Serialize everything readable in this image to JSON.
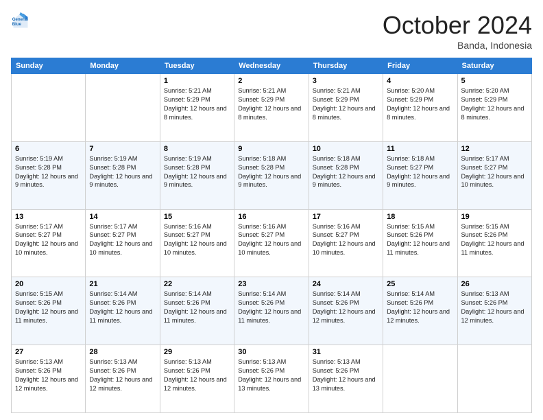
{
  "logo": {
    "line1": "General",
    "line2": "Blue"
  },
  "header": {
    "month": "October 2024",
    "location": "Banda, Indonesia"
  },
  "weekdays": [
    "Sunday",
    "Monday",
    "Tuesday",
    "Wednesday",
    "Thursday",
    "Friday",
    "Saturday"
  ],
  "weeks": [
    [
      {
        "day": null,
        "sunrise": null,
        "sunset": null,
        "daylight": null
      },
      {
        "day": null,
        "sunrise": null,
        "sunset": null,
        "daylight": null
      },
      {
        "day": "1",
        "sunrise": "Sunrise: 5:21 AM",
        "sunset": "Sunset: 5:29 PM",
        "daylight": "Daylight: 12 hours and 8 minutes."
      },
      {
        "day": "2",
        "sunrise": "Sunrise: 5:21 AM",
        "sunset": "Sunset: 5:29 PM",
        "daylight": "Daylight: 12 hours and 8 minutes."
      },
      {
        "day": "3",
        "sunrise": "Sunrise: 5:21 AM",
        "sunset": "Sunset: 5:29 PM",
        "daylight": "Daylight: 12 hours and 8 minutes."
      },
      {
        "day": "4",
        "sunrise": "Sunrise: 5:20 AM",
        "sunset": "Sunset: 5:29 PM",
        "daylight": "Daylight: 12 hours and 8 minutes."
      },
      {
        "day": "5",
        "sunrise": "Sunrise: 5:20 AM",
        "sunset": "Sunset: 5:29 PM",
        "daylight": "Daylight: 12 hours and 8 minutes."
      }
    ],
    [
      {
        "day": "6",
        "sunrise": "Sunrise: 5:19 AM",
        "sunset": "Sunset: 5:28 PM",
        "daylight": "Daylight: 12 hours and 9 minutes."
      },
      {
        "day": "7",
        "sunrise": "Sunrise: 5:19 AM",
        "sunset": "Sunset: 5:28 PM",
        "daylight": "Daylight: 12 hours and 9 minutes."
      },
      {
        "day": "8",
        "sunrise": "Sunrise: 5:19 AM",
        "sunset": "Sunset: 5:28 PM",
        "daylight": "Daylight: 12 hours and 9 minutes."
      },
      {
        "day": "9",
        "sunrise": "Sunrise: 5:18 AM",
        "sunset": "Sunset: 5:28 PM",
        "daylight": "Daylight: 12 hours and 9 minutes."
      },
      {
        "day": "10",
        "sunrise": "Sunrise: 5:18 AM",
        "sunset": "Sunset: 5:28 PM",
        "daylight": "Daylight: 12 hours and 9 minutes."
      },
      {
        "day": "11",
        "sunrise": "Sunrise: 5:18 AM",
        "sunset": "Sunset: 5:27 PM",
        "daylight": "Daylight: 12 hours and 9 minutes."
      },
      {
        "day": "12",
        "sunrise": "Sunrise: 5:17 AM",
        "sunset": "Sunset: 5:27 PM",
        "daylight": "Daylight: 12 hours and 10 minutes."
      }
    ],
    [
      {
        "day": "13",
        "sunrise": "Sunrise: 5:17 AM",
        "sunset": "Sunset: 5:27 PM",
        "daylight": "Daylight: 12 hours and 10 minutes."
      },
      {
        "day": "14",
        "sunrise": "Sunrise: 5:17 AM",
        "sunset": "Sunset: 5:27 PM",
        "daylight": "Daylight: 12 hours and 10 minutes."
      },
      {
        "day": "15",
        "sunrise": "Sunrise: 5:16 AM",
        "sunset": "Sunset: 5:27 PM",
        "daylight": "Daylight: 12 hours and 10 minutes."
      },
      {
        "day": "16",
        "sunrise": "Sunrise: 5:16 AM",
        "sunset": "Sunset: 5:27 PM",
        "daylight": "Daylight: 12 hours and 10 minutes."
      },
      {
        "day": "17",
        "sunrise": "Sunrise: 5:16 AM",
        "sunset": "Sunset: 5:27 PM",
        "daylight": "Daylight: 12 hours and 10 minutes."
      },
      {
        "day": "18",
        "sunrise": "Sunrise: 5:15 AM",
        "sunset": "Sunset: 5:26 PM",
        "daylight": "Daylight: 12 hours and 11 minutes."
      },
      {
        "day": "19",
        "sunrise": "Sunrise: 5:15 AM",
        "sunset": "Sunset: 5:26 PM",
        "daylight": "Daylight: 12 hours and 11 minutes."
      }
    ],
    [
      {
        "day": "20",
        "sunrise": "Sunrise: 5:15 AM",
        "sunset": "Sunset: 5:26 PM",
        "daylight": "Daylight: 12 hours and 11 minutes."
      },
      {
        "day": "21",
        "sunrise": "Sunrise: 5:14 AM",
        "sunset": "Sunset: 5:26 PM",
        "daylight": "Daylight: 12 hours and 11 minutes."
      },
      {
        "day": "22",
        "sunrise": "Sunrise: 5:14 AM",
        "sunset": "Sunset: 5:26 PM",
        "daylight": "Daylight: 12 hours and 11 minutes."
      },
      {
        "day": "23",
        "sunrise": "Sunrise: 5:14 AM",
        "sunset": "Sunset: 5:26 PM",
        "daylight": "Daylight: 12 hours and 11 minutes."
      },
      {
        "day": "24",
        "sunrise": "Sunrise: 5:14 AM",
        "sunset": "Sunset: 5:26 PM",
        "daylight": "Daylight: 12 hours and 12 minutes."
      },
      {
        "day": "25",
        "sunrise": "Sunrise: 5:14 AM",
        "sunset": "Sunset: 5:26 PM",
        "daylight": "Daylight: 12 hours and 12 minutes."
      },
      {
        "day": "26",
        "sunrise": "Sunrise: 5:13 AM",
        "sunset": "Sunset: 5:26 PM",
        "daylight": "Daylight: 12 hours and 12 minutes."
      }
    ],
    [
      {
        "day": "27",
        "sunrise": "Sunrise: 5:13 AM",
        "sunset": "Sunset: 5:26 PM",
        "daylight": "Daylight: 12 hours and 12 minutes."
      },
      {
        "day": "28",
        "sunrise": "Sunrise: 5:13 AM",
        "sunset": "Sunset: 5:26 PM",
        "daylight": "Daylight: 12 hours and 12 minutes."
      },
      {
        "day": "29",
        "sunrise": "Sunrise: 5:13 AM",
        "sunset": "Sunset: 5:26 PM",
        "daylight": "Daylight: 12 hours and 12 minutes."
      },
      {
        "day": "30",
        "sunrise": "Sunrise: 5:13 AM",
        "sunset": "Sunset: 5:26 PM",
        "daylight": "Daylight: 12 hours and 13 minutes."
      },
      {
        "day": "31",
        "sunrise": "Sunrise: 5:13 AM",
        "sunset": "Sunset: 5:26 PM",
        "daylight": "Daylight: 12 hours and 13 minutes."
      },
      {
        "day": null,
        "sunrise": null,
        "sunset": null,
        "daylight": null
      },
      {
        "day": null,
        "sunrise": null,
        "sunset": null,
        "daylight": null
      }
    ]
  ]
}
